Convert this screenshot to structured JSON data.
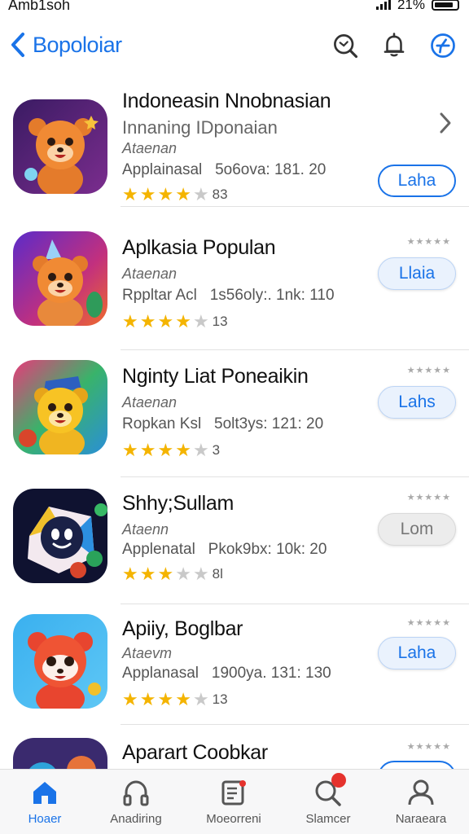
{
  "status": {
    "carrier": "Amb1soh",
    "battery_text": "21%"
  },
  "nav": {
    "back_label": "Bopoloiar",
    "icons": [
      "search-icon",
      "bell-icon",
      "compass-icon"
    ]
  },
  "apps": [
    {
      "title": "Indoneasin Nnobnasian",
      "subtitle": "Innaning IDponaian",
      "category": "Ataenan",
      "meta_label": "Applainasal",
      "meta_value": "5o6ova: 181. 20",
      "rating": 4,
      "rating_count": "83",
      "button": "Laha",
      "button_style": "outline"
    },
    {
      "title": "Aplkasia Populan",
      "subtitle": "",
      "category": "Ataenan",
      "meta_label": "Rppltar Acl",
      "meta_value": "1s56oly:. 1nk: 110",
      "rating": 3.5,
      "rating_count": "13",
      "button": "Llaia",
      "button_style": "soft"
    },
    {
      "title": "Nginty Liat Poneaikin",
      "subtitle": "",
      "category": "Ataenan",
      "meta_label": "Ropkan Ksl",
      "meta_value": "5olt3ys: 121: 20",
      "rating": 4,
      "rating_count": "3",
      "button": "Lahs",
      "button_style": "soft"
    },
    {
      "title": "Shhy;Sullam",
      "subtitle": "",
      "category": "Ataenn",
      "meta_label": "Applenatal",
      "meta_value": "Pkok9bx: 10k: 20",
      "rating": 3,
      "rating_count": "8l",
      "button": "Lom",
      "button_style": "grey"
    },
    {
      "title": "Apiiy, Boglbar",
      "subtitle": "",
      "category": "Ataevm",
      "meta_label": "Applanasal",
      "meta_value": "1900ya. 131: 130",
      "rating": 3.5,
      "rating_count": "13",
      "button": "Laha",
      "button_style": "soft"
    },
    {
      "title": "Aparart Coobkar",
      "subtitle": "",
      "category": "",
      "meta_label": "",
      "meta_value": "",
      "rating": 0,
      "rating_count": "",
      "button": "",
      "button_style": "outline"
    }
  ],
  "tabs": [
    {
      "label": "Hoaer",
      "icon": "home-icon",
      "active": true
    },
    {
      "label": "Anadiring",
      "icon": "headphones-icon",
      "active": false
    },
    {
      "label": "Moeorreni",
      "icon": "notes-icon",
      "active": false
    },
    {
      "label": "Slamcer",
      "icon": "search-tab-icon",
      "active": false
    },
    {
      "label": "Naraeara",
      "icon": "profile-icon",
      "active": false
    }
  ],
  "colors": {
    "accent": "#1a73e8",
    "star": "#f4b400",
    "badge": "#e5322d"
  }
}
